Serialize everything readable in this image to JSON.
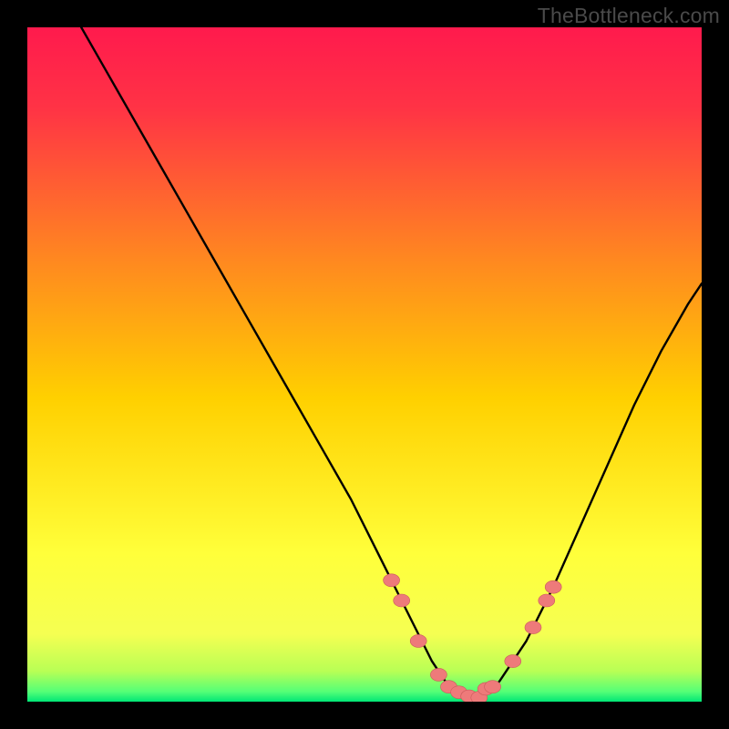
{
  "watermark": "TheBottleneck.com",
  "colors": {
    "bg": "#000000",
    "gradient_top": "#ff1a4d",
    "gradient_mid": "#ffd000",
    "gradient_low": "#f5ff52",
    "gradient_bottom": "#00e676",
    "curve": "#000000",
    "marker_fill": "#ee7a7a",
    "marker_stroke": "#c95b5b"
  },
  "chart_data": {
    "type": "line",
    "title": "",
    "xlabel": "",
    "ylabel": "",
    "xlim": [
      0,
      100
    ],
    "ylim": [
      0,
      100
    ],
    "series": [
      {
        "name": "curve",
        "x": [
          8,
          12,
          16,
          20,
          24,
          28,
          32,
          36,
          40,
          44,
          48,
          52,
          55,
          58,
          60,
          62,
          64,
          66,
          68,
          70,
          74,
          78,
          82,
          86,
          90,
          94,
          98,
          100
        ],
        "y": [
          100,
          93,
          86,
          79,
          72,
          65,
          58,
          51,
          44,
          37,
          30,
          22,
          16,
          10,
          6,
          3,
          1,
          0.5,
          1,
          3,
          9,
          17,
          26,
          35,
          44,
          52,
          59,
          62
        ]
      }
    ],
    "markers": {
      "name": "highlight-points",
      "points": [
        {
          "x": 54,
          "y": 18
        },
        {
          "x": 55.5,
          "y": 15
        },
        {
          "x": 58,
          "y": 9
        },
        {
          "x": 61,
          "y": 4
        },
        {
          "x": 62.5,
          "y": 2.2
        },
        {
          "x": 64,
          "y": 1.4
        },
        {
          "x": 65.5,
          "y": 0.8
        },
        {
          "x": 67,
          "y": 0.6
        },
        {
          "x": 68,
          "y": 1.9
        },
        {
          "x": 69,
          "y": 2.2
        },
        {
          "x": 72,
          "y": 6
        },
        {
          "x": 75,
          "y": 11
        },
        {
          "x": 77,
          "y": 15
        },
        {
          "x": 78,
          "y": 17
        }
      ]
    }
  }
}
